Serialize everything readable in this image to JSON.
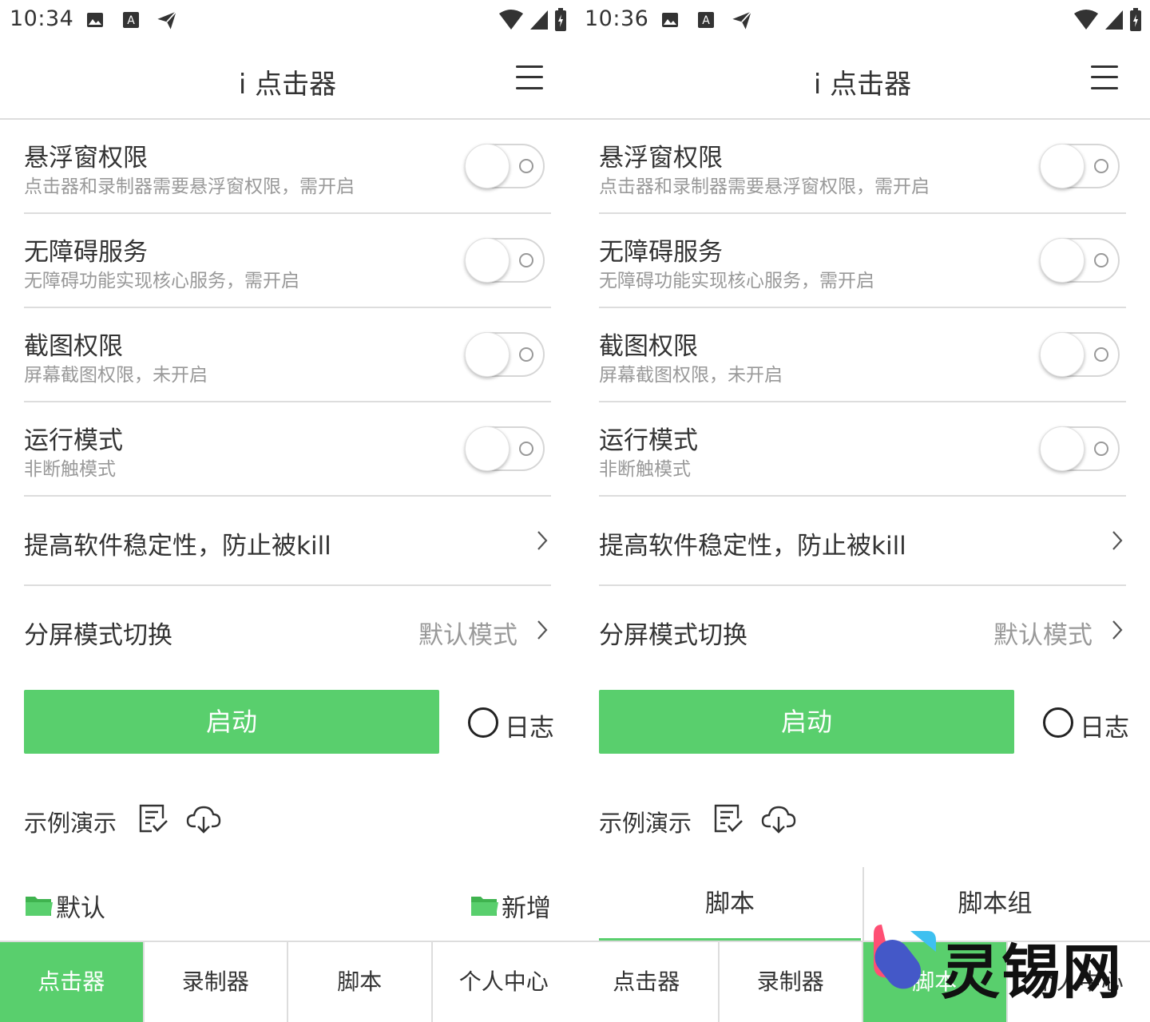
{
  "app_title": "i 点击器",
  "colors": {
    "accent": "#59cf6d",
    "divider": "#dddddd",
    "subtext": "#999999"
  },
  "left": {
    "status_time": "10:34",
    "bottom_active_tab": "点击器"
  },
  "right": {
    "status_time": "10:36",
    "bottom_active_tab": "脚本"
  },
  "settings": {
    "overlay": {
      "title": "悬浮窗权限",
      "subtitle": "点击器和录制器需要悬浮窗权限，需开启",
      "enabled": false
    },
    "accessibility": {
      "title": "无障碍服务",
      "subtitle": "无障碍功能实现核心服务，需开启",
      "enabled": false
    },
    "screenshot": {
      "title": "截图权限",
      "subtitle": "屏幕截图权限，未开启",
      "enabled": false
    },
    "run_mode": {
      "title": "运行模式",
      "subtitle": "非断触模式",
      "enabled": false
    },
    "stability": {
      "title": "提高软件稳定性，防止被kill"
    },
    "split_screen": {
      "title": "分屏模式切换",
      "value": "默认模式"
    }
  },
  "start_button": "启动",
  "log_label": "日志",
  "demo_label": "示例演示",
  "folders": {
    "default": "默认",
    "new": "新增"
  },
  "script_tabs": [
    "脚本",
    "脚本组"
  ],
  "bottom_nav": [
    "点击器",
    "录制器",
    "脚本",
    "个人中心"
  ],
  "watermark": "灵锡网",
  "icons": [
    "image-icon",
    "a-icon",
    "send-icon",
    "wifi-icon",
    "signal-icon",
    "battery-icon",
    "menu-icon",
    "chevron-right-icon",
    "checklist-icon",
    "cloud-download-icon",
    "folder-icon"
  ]
}
